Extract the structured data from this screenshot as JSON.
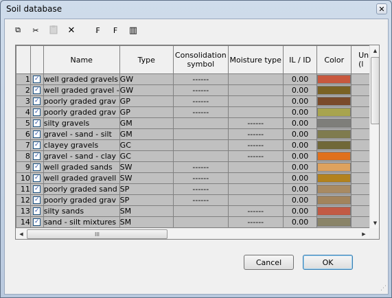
{
  "window": {
    "title": "Soil database",
    "close_glyph": "✕"
  },
  "toolbar": {
    "buttons": [
      {
        "icon": "copy-icon",
        "glyph": "⧉"
      },
      {
        "icon": "cut-icon",
        "glyph": "✂"
      },
      {
        "icon": "paste-icon",
        "glyph": "📋"
      },
      {
        "icon": "delete-icon",
        "glyph": "✕"
      },
      {
        "icon": "sort-icon",
        "glyph": "₣"
      },
      {
        "icon": "filter-icon",
        "glyph": "F"
      },
      {
        "icon": "columns-icon",
        "glyph": "▥"
      }
    ]
  },
  "grid": {
    "columns": {
      "num": "",
      "check": "",
      "name": "Name",
      "type": "Type",
      "consolidation": "Consolidation symbol",
      "moisture": "Moisture type",
      "il": "IL / ID",
      "color": "Color",
      "unit": "Uni (l"
    },
    "rows": [
      {
        "num": "1",
        "checked": true,
        "name": "well graded gravels",
        "type": "GW",
        "consolidation": "------",
        "moisture": "",
        "il": "0.00",
        "color": "#c8583e"
      },
      {
        "num": "2",
        "checked": true,
        "name": "well graded gravel -",
        "type": "GW",
        "consolidation": "------",
        "moisture": "",
        "il": "0.00",
        "color": "#7a6224"
      },
      {
        "num": "3",
        "checked": true,
        "name": "poorly graded grav",
        "type": "GP",
        "consolidation": "------",
        "moisture": "",
        "il": "0.00",
        "color": "#7a4a2a"
      },
      {
        "num": "4",
        "checked": true,
        "name": "poorly graded grav",
        "type": "GP",
        "consolidation": "------",
        "moisture": "",
        "il": "0.00",
        "color": "#a8a44e"
      },
      {
        "num": "5",
        "checked": true,
        "name": "silty gravels",
        "type": "GM",
        "consolidation": "",
        "moisture": "------",
        "il": "0.00",
        "color": "#7e7e7a"
      },
      {
        "num": "6",
        "checked": true,
        "name": "gravel - sand - silt",
        "type": "GM",
        "consolidation": "",
        "moisture": "------",
        "il": "0.00",
        "color": "#7f7b4e"
      },
      {
        "num": "7",
        "checked": true,
        "name": "clayey gravels",
        "type": "GC",
        "consolidation": "",
        "moisture": "------",
        "il": "0.00",
        "color": "#706838"
      },
      {
        "num": "8",
        "checked": true,
        "name": "gravel - sand - clay",
        "type": "GC",
        "consolidation": "",
        "moisture": "------",
        "il": "0.00",
        "color": "#e0701c"
      },
      {
        "num": "9",
        "checked": true,
        "name": "well graded sands",
        "type": "SW",
        "consolidation": "------",
        "moisture": "",
        "il": "0.00",
        "color": "#dea25e"
      },
      {
        "num": "10",
        "checked": true,
        "name": "well graded gravell",
        "type": "SW",
        "consolidation": "------",
        "moisture": "",
        "il": "0.00",
        "color": "#b2821e"
      },
      {
        "num": "11",
        "checked": true,
        "name": "poorly graded sand",
        "type": "SP",
        "consolidation": "------",
        "moisture": "",
        "il": "0.00",
        "color": "#a88a62"
      },
      {
        "num": "12",
        "checked": true,
        "name": "poorly graded grav",
        "type": "SP",
        "consolidation": "------",
        "moisture": "",
        "il": "0.00",
        "color": "#a2845c"
      },
      {
        "num": "13",
        "checked": true,
        "name": "silty sands",
        "type": "SM",
        "consolidation": "",
        "moisture": "------",
        "il": "0.00",
        "color": "#c25a44"
      },
      {
        "num": "14",
        "checked": true,
        "name": "sand - silt mixtures",
        "type": "SM",
        "consolidation": "",
        "moisture": "------",
        "il": "0.00",
        "color": "#8a8468"
      }
    ]
  },
  "scrollbars": {
    "h_thumb_grip": "III",
    "left": "◀",
    "right": "▶",
    "up": "▲",
    "down": "▼"
  },
  "buttons": {
    "cancel": "Cancel",
    "ok": "OK"
  },
  "grip": "⋰"
}
